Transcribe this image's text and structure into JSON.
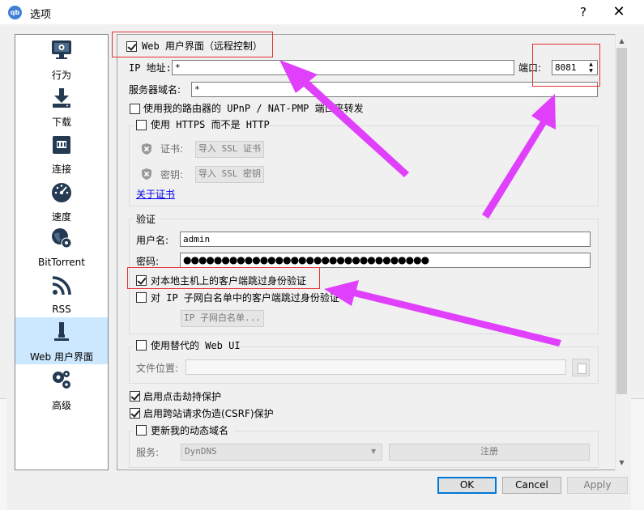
{
  "window": {
    "title": "选项",
    "app_icon_text": "qb",
    "help_glyph": "?",
    "close_glyph": "✕"
  },
  "sidebar": {
    "items": [
      {
        "label": "行为",
        "icon": "monitor-icon"
      },
      {
        "label": "下载",
        "icon": "download-icon"
      },
      {
        "label": "连接",
        "icon": "network-icon"
      },
      {
        "label": "速度",
        "icon": "speedometer-icon"
      },
      {
        "label": "BitTorrent",
        "icon": "globe-gear-icon"
      },
      {
        "label": "RSS",
        "icon": "rss-icon"
      },
      {
        "label": "Web 用户界面",
        "icon": "ethernet-icon",
        "selected": true
      },
      {
        "label": "高级",
        "icon": "gears-icon"
      }
    ]
  },
  "webui": {
    "enable_label": "Web 用户界面（远程控制）",
    "enable_checked": true,
    "ip_label": "IP 地址:",
    "ip_value": "*",
    "port_label": "端口:",
    "port_value": "8081",
    "domain_label": "服务器域名:",
    "domain_value": "*",
    "upnp_label": "使用我的路由器的 UPnP / NAT-PMP 端口来转发",
    "upnp_checked": false,
    "https_label": "使用 HTTPS 而不是 HTTP",
    "https_checked": false,
    "cert_label": "证书:",
    "cert_button": "导入 SSL 证书",
    "key_label": "密钥:",
    "key_button": "导入 SSL 密钥",
    "about_cert_link": "关于证书"
  },
  "auth": {
    "group_title": "验证",
    "username_label": "用户名:",
    "username_value": "admin",
    "password_label": "密码:",
    "password_value": "●●●●●●●●●●●●●●●●●●●●●●●●●●●●●●●●",
    "bypass_local_label": "对本地主机上的客户端跳过身份验证",
    "bypass_local_checked": true,
    "bypass_whitelist_label": "对 IP 子网白名单中的客户端跳过身份验证",
    "bypass_whitelist_checked": false,
    "whitelist_button": "IP 子网白名单..."
  },
  "alt_webui": {
    "label": "使用替代的 Web UI",
    "checked": false,
    "files_label": "文件位置:",
    "files_value": ""
  },
  "security": {
    "clickjacking_label": "启用点击劫持保护",
    "clickjacking_checked": true,
    "csrf_label": "启用跨站请求伪造(CSRF)保护",
    "csrf_checked": true
  },
  "dyndns": {
    "label": "更新我的动态域名",
    "checked": false,
    "service_label": "服务:",
    "service_value": "DynDNS",
    "register_button": "注册"
  },
  "footer": {
    "ok": "OK",
    "cancel": "Cancel",
    "apply": "Apply"
  },
  "colors": {
    "annotation_arrow": "#e040fb",
    "annotation_box": "#e53333",
    "selection": "#cce8ff",
    "default_button_border": "#0078d7"
  }
}
